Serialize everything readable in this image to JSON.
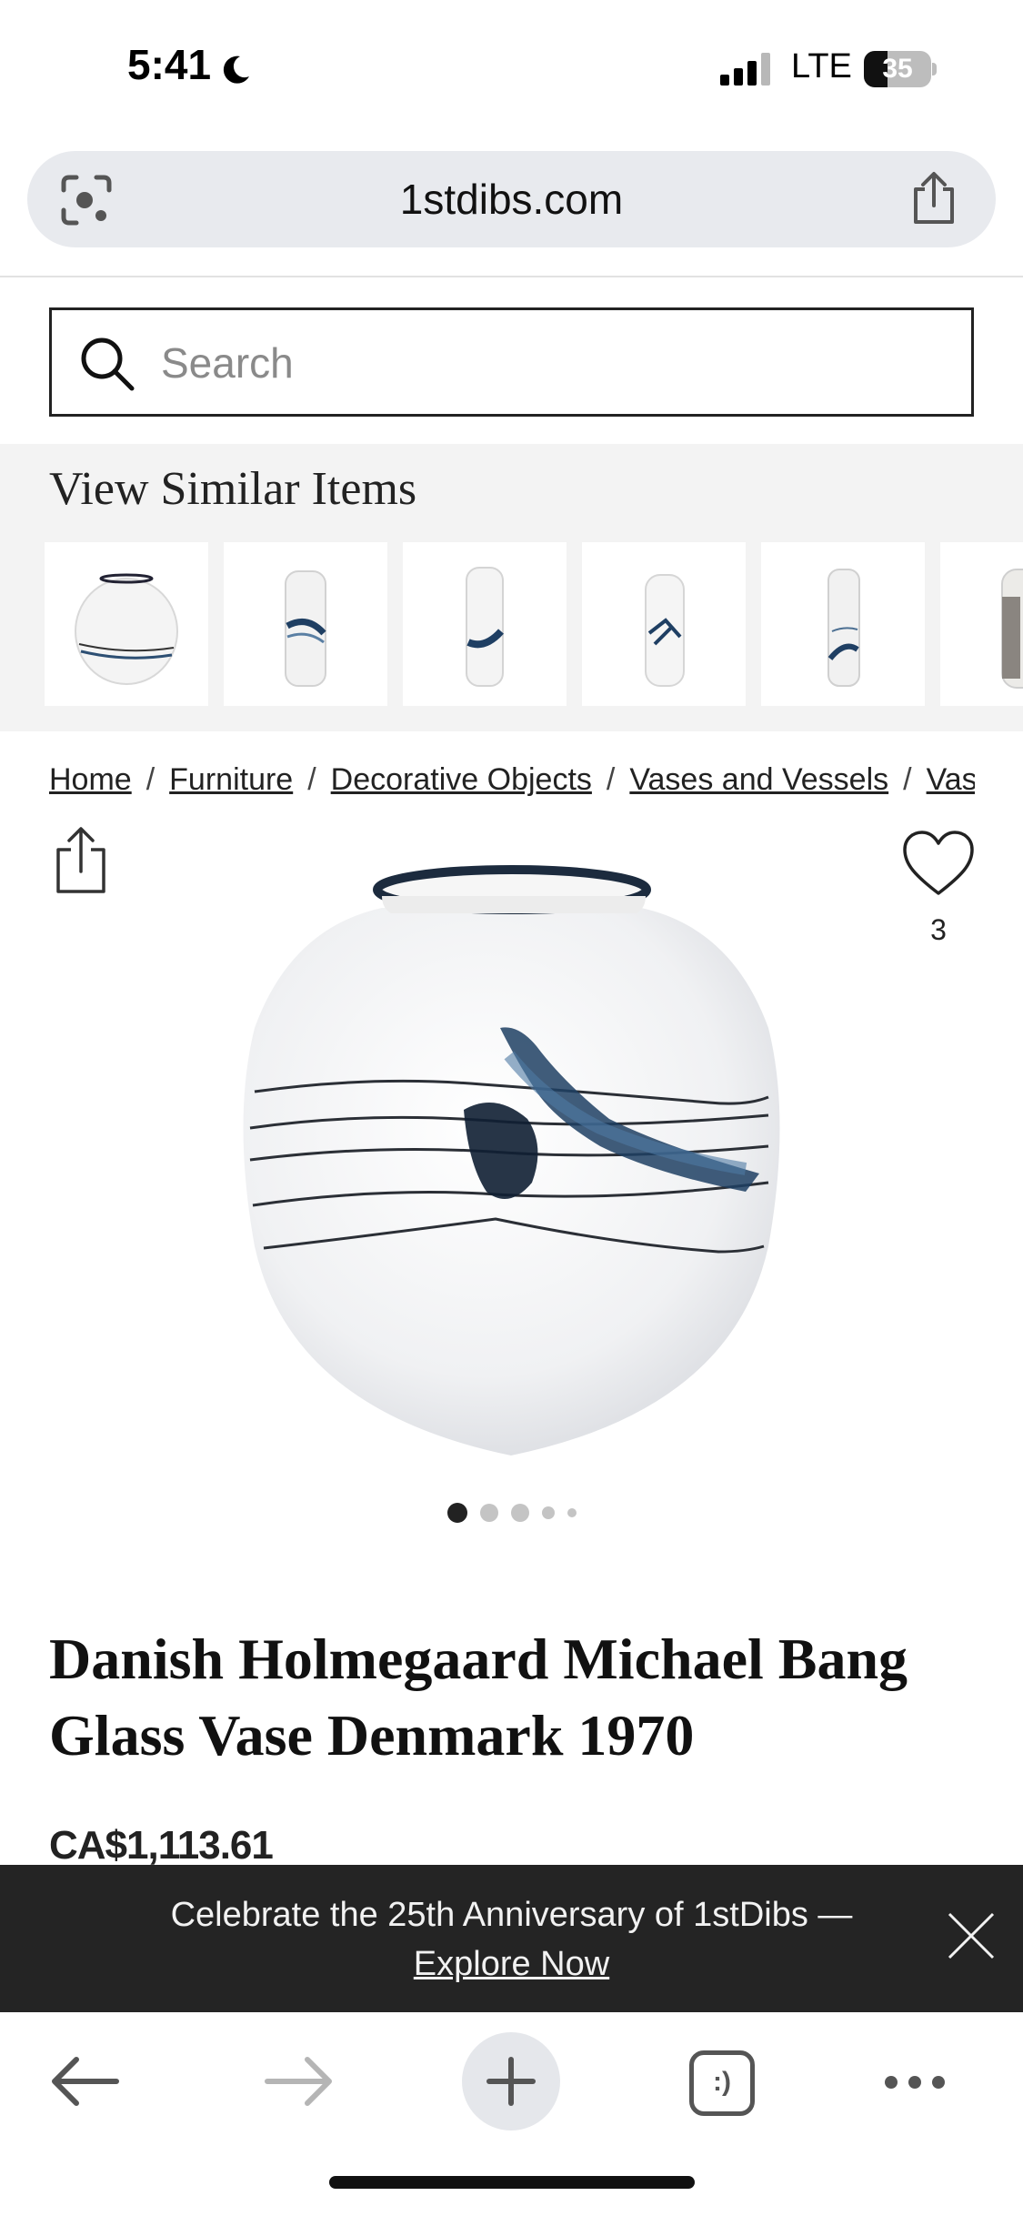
{
  "status_bar": {
    "time": "5:41",
    "network": "LTE",
    "battery_level": "35",
    "battery_fraction": 0.35
  },
  "browser": {
    "url": "1stdibs.com"
  },
  "search": {
    "placeholder": "Search"
  },
  "similar": {
    "title": "View Similar Items",
    "items": [
      {
        "kind": "round-vase"
      },
      {
        "kind": "tall-vase"
      },
      {
        "kind": "tall-vase"
      },
      {
        "kind": "tall-vase"
      },
      {
        "kind": "slim-vase"
      },
      {
        "kind": "tall-vase"
      }
    ]
  },
  "breadcrumb": {
    "items": [
      "Home",
      "Furniture",
      "Decorative Objects",
      "Vases and Vessels",
      "Vases"
    ],
    "separator": "/"
  },
  "product": {
    "favorites_count": "3",
    "title": "Danish Holmegaard Michael Bang Glass Vase Denmark 1970",
    "price": "CA$1,113.61",
    "image_count": 5,
    "current_image": 1
  },
  "banner": {
    "text": "Celebrate the 25th Anniversary of 1stDibs —",
    "link": "Explore Now"
  },
  "colors": {
    "banner_bg": "#242424",
    "url_bar_bg": "#e8eaee",
    "similar_bg": "#f3f3f3",
    "vase_accent": "#1f3f63"
  },
  "icons": [
    "moon-icon",
    "signal-icon",
    "battery-icon",
    "lens-icon",
    "share-icon",
    "search-icon",
    "heart-icon",
    "close-icon",
    "back-arrow-icon",
    "forward-arrow-icon",
    "plus-icon",
    "tabs-icon",
    "more-icon"
  ]
}
